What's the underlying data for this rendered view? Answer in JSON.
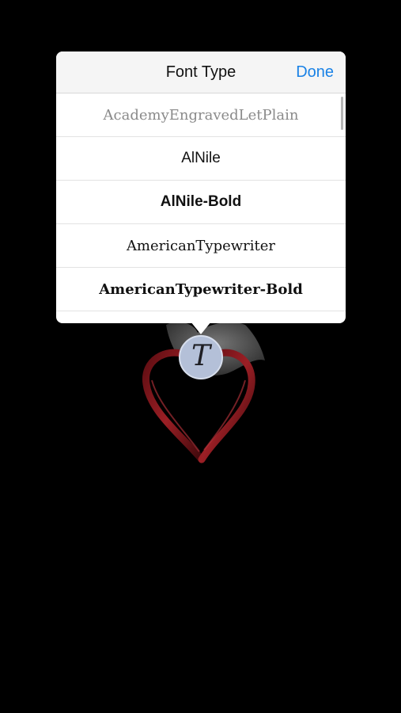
{
  "popover": {
    "title": "Font Type",
    "done_label": "Done"
  },
  "font_list": {
    "items": [
      {
        "label": "AcademyEngravedLetPlain"
      },
      {
        "label": "AlNile"
      },
      {
        "label": "AlNile-Bold"
      },
      {
        "label": "AmericanTypewriter"
      },
      {
        "label": "AmericanTypewriter-Bold"
      }
    ]
  },
  "tool_button": {
    "glyph": "T",
    "icon": "font-type-icon"
  },
  "colors": {
    "background": "#000000",
    "accent": "#1a82e6",
    "ribbon": "#8b1a1f",
    "tool_button": "#b4c0d8"
  }
}
